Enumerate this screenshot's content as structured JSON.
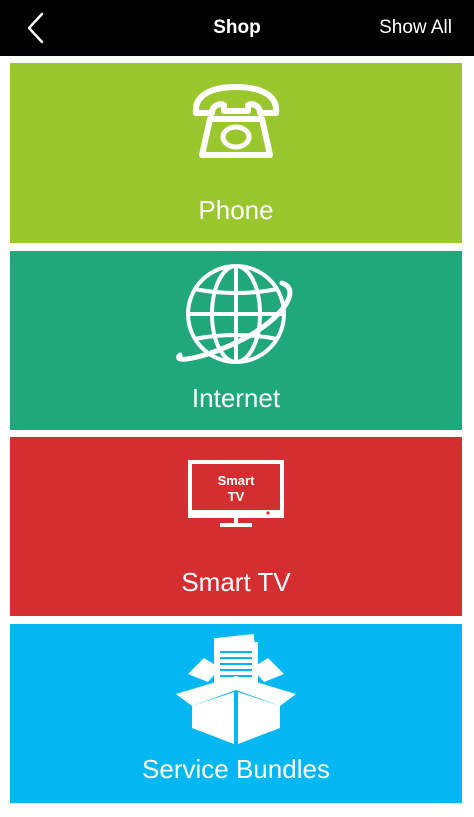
{
  "navbar": {
    "title": "Shop",
    "show_all_label": "Show All",
    "back_icon": "chevron-left-icon"
  },
  "tiles": [
    {
      "label": "Phone",
      "icon": "telephone-icon",
      "color": "#9ac72d"
    },
    {
      "label": "Internet",
      "icon": "globe-icon",
      "color": "#20a87a"
    },
    {
      "label": "Smart TV",
      "icon": "smart-tv-icon",
      "color": "#d42e31",
      "icon_text_line1": "Smart",
      "icon_text_line2": "TV"
    },
    {
      "label": "Service Bundles",
      "icon": "open-box-icon",
      "color": "#03b7f2"
    }
  ]
}
